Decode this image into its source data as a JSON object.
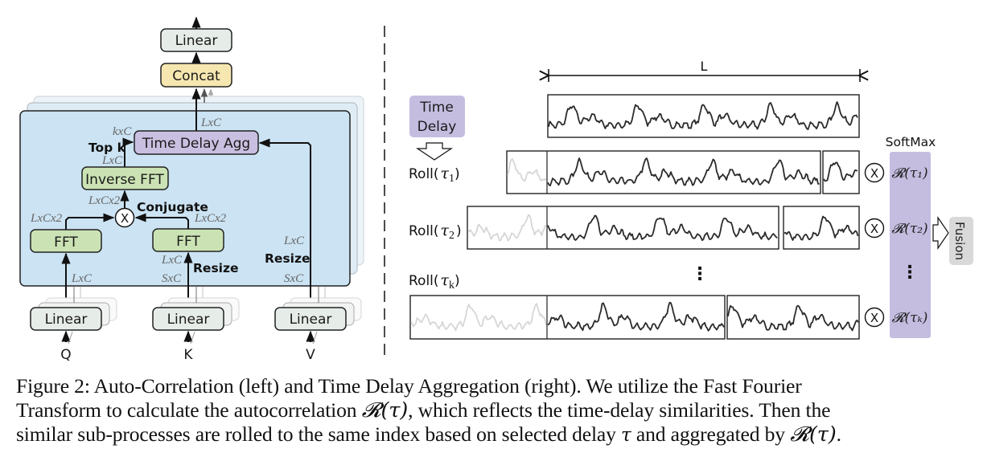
{
  "left_diagram": {
    "title": "Auto-Correlation",
    "output_linear": "Linear",
    "concat": "Concat",
    "time_delay_agg": "Time Delay Agg",
    "inverse_fft": "Inverse FFT",
    "fft_q": "FFT",
    "fft_k": "FFT",
    "multiply": "X",
    "conjugate": "Conjugate",
    "top_k": "Top k",
    "resize_k": "Resize",
    "resize_v": "Resize",
    "linear_q": "Linear",
    "linear_k": "Linear",
    "linear_v": "Linear",
    "input_q": "Q",
    "input_k": "K",
    "input_v": "V",
    "dims": {
      "agg_out": "LxC",
      "topk_in": "kxC",
      "ifft_out": "LxC",
      "mult_out": "LxCx2",
      "fft_q_out": "LxCx2",
      "fft_k_out": "LxCx2",
      "q_in": "LxC",
      "k_resized": "LxC",
      "k_in": "SxC",
      "v_resized": "LxC",
      "v_in": "SxC"
    },
    "colors": {
      "panel": "#cbe3f3",
      "linear": "#e6ece8",
      "concat": "#f6e7b0",
      "agg": "#c9bfe0",
      "fft": "#cbe3b4"
    }
  },
  "right_diagram": {
    "title": "Time Delay Aggregation",
    "length_label": "L",
    "time_delay_box": [
      "Time",
      "Delay"
    ],
    "rows": [
      {
        "roll": "Roll(",
        "tau": "τ",
        "sub": "1",
        "close": ")",
        "weight": "𝓡(τ₁)"
      },
      {
        "roll": "Roll(",
        "tau": "τ",
        "sub": "2",
        "close": ")",
        "weight": "𝓡(τ₂)"
      },
      {
        "roll": "Roll(",
        "tau": "τ",
        "sub": "k",
        "close": ")",
        "weight": "𝓡(τₖ)"
      }
    ],
    "multiply": "X",
    "softmax": "SoftMax",
    "ellipsis": "⋮",
    "fusion": "Fusion",
    "colors": {
      "softmax_panel": "#c4bde0",
      "time_delay_box": "#c4bde0",
      "fusion_box": "#d9d9d9",
      "series_active": "#2b2b2b",
      "series_faded": "#d6d6d6"
    }
  },
  "caption": {
    "line1": "Figure 2: Auto-Correlation (left) and Time Delay Aggregation (right). We utilize the Fast Fourier",
    "line2a": "Transform to calculate the autocorrelation ",
    "line2b": ", which reflects the time-delay similarities. Then the",
    "line3a": "similar sub-processes are rolled to the same index based on selected delay ",
    "line3b": " and aggregated by ",
    "line3c": ".",
    "r_tau": "𝓡(τ)",
    "tau": "τ"
  }
}
